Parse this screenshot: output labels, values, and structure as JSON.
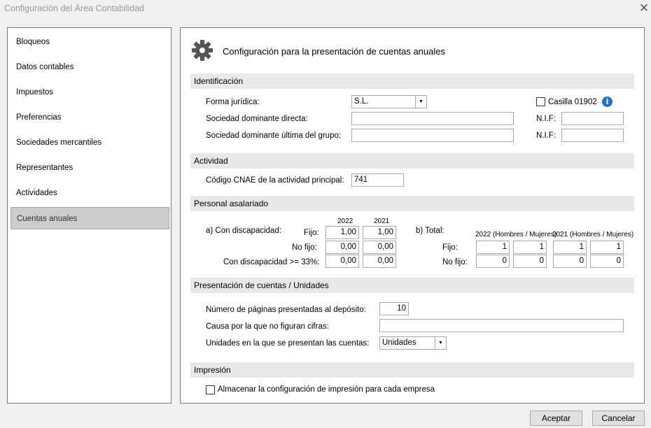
{
  "window": {
    "title": "Configuración del Área Contabilidad"
  },
  "sidebar": {
    "items": [
      {
        "label": "Bloqueos"
      },
      {
        "label": "Datos contables"
      },
      {
        "label": "Impuestos"
      },
      {
        "label": "Preferencias"
      },
      {
        "label": "Sociedades mercantiles"
      },
      {
        "label": "Representantes"
      },
      {
        "label": "Actividades"
      },
      {
        "label": "Cuentas anuales"
      }
    ],
    "active_index": 7
  },
  "panel": {
    "title": "Configuración para la presentación de cuentas anuales",
    "identificacion": {
      "header": "Identificación",
      "forma_juridica_label": "Forma jurídica:",
      "forma_juridica_value": "S.L.",
      "casilla_label": "Casilla 01902",
      "casilla_checked": false,
      "dominante_directa_label": "Sociedad dominante directa:",
      "dominante_directa_value": "",
      "dominante_ultima_label": "Sociedad dominante última del grupo:",
      "dominante_ultima_value": "",
      "nif_label": "N.I.F:",
      "nif1_value": "",
      "nif2_value": ""
    },
    "actividad": {
      "header": "Actividad",
      "cnae_label": "Código CNAE de la actividad principal:",
      "cnae_value": "741"
    },
    "personal": {
      "header": "Personal asalariado",
      "a_label": "a) Con discapacidad:",
      "year_2022": "2022",
      "year_2021": "2021",
      "fijo_label": "Fijo:",
      "nofijo_label": "No fijo:",
      "discap_label": "Con discapacidad >= 33%:",
      "a_fijo_2022": "1,00",
      "a_fijo_2021": "1,00",
      "a_nofijo_2022": "0,00",
      "a_nofijo_2021": "0,00",
      "a_discap_2022": "0,00",
      "a_discap_2021": "0,00",
      "b_label": "b) Total:",
      "b_2022_header": "2022 (Hombres / Mujeres)",
      "b_2021_header": "2021 (Hombres / Mujeres)",
      "b_fijo_2022_h": "1",
      "b_fijo_2022_m": "1",
      "b_fijo_2021_h": "1",
      "b_fijo_2021_m": "1",
      "b_nofijo_2022_h": "0",
      "b_nofijo_2022_m": "0",
      "b_nofijo_2021_h": "0",
      "b_nofijo_2021_m": "0"
    },
    "presentacion": {
      "header": "Presentación de cuentas / Unidades",
      "paginas_label": "Número de páginas presentadas al depósito:",
      "paginas_value": "10",
      "causa_label": "Causa por la que no figuran cifras:",
      "causa_value": "",
      "unidades_label": "Unidades en la que se presentan las cuentas:",
      "unidades_value": "Unidades"
    },
    "impresion": {
      "header": "Impresión",
      "almacenar_label": "Almacenar la configuración de impresión para cada empresa",
      "almacenar_checked": false
    }
  },
  "footer": {
    "accept_label": "Aceptar",
    "cancel_label": "Cancelar"
  },
  "icons": {
    "close": "close-icon",
    "gear": "gear-icon",
    "info": "info-icon",
    "dropdown": "chevron-down-icon"
  }
}
